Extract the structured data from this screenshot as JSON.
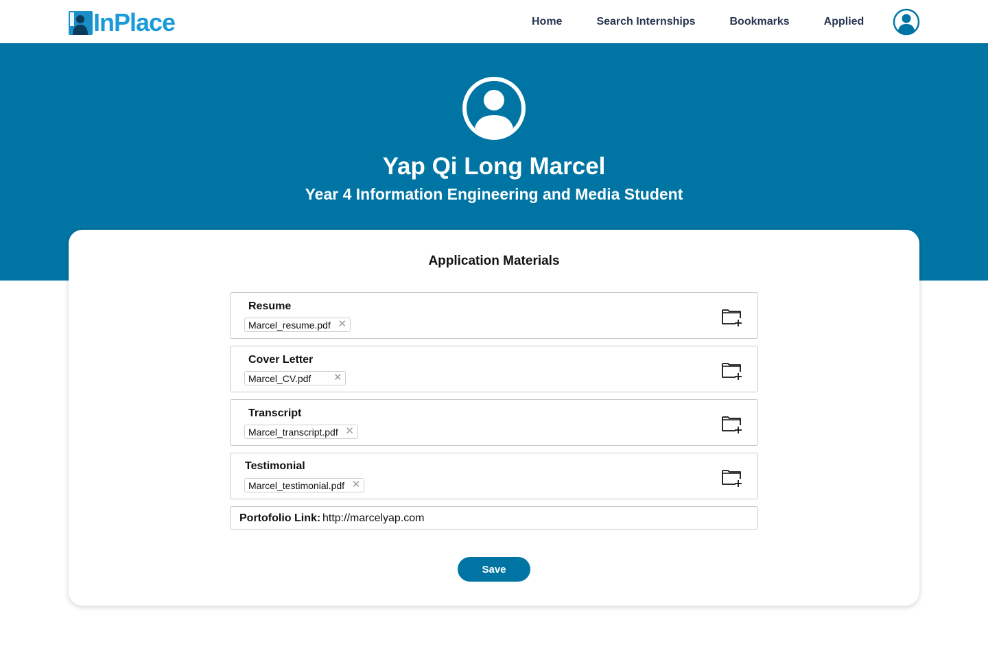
{
  "brand": {
    "logo_text": "InPlace",
    "logo_icon": "person-badge-icon",
    "color": "#1a9ad6"
  },
  "nav": {
    "items": [
      {
        "label": "Home"
      },
      {
        "label": "Search Internships"
      },
      {
        "label": "Bookmarks"
      },
      {
        "label": "Applied"
      }
    ],
    "avatar_icon": "user-circle-icon"
  },
  "profile": {
    "name": "Yap Qi Long Marcel",
    "subtitle": "Year 4 Information Engineering and Media Student",
    "avatar_icon": "user-circle-icon"
  },
  "materials": {
    "title": "Application Materials",
    "items": [
      {
        "label": "Resume",
        "file": "Marcel_resume.pdf",
        "remove_icon": "close-icon",
        "upload_icon": "folder-add-icon"
      },
      {
        "label": "Cover Letter",
        "file": "Marcel_CV.pdf",
        "remove_icon": "close-icon",
        "upload_icon": "folder-add-icon"
      },
      {
        "label": "Transcript",
        "file": "Marcel_transcript.pdf",
        "remove_icon": "close-icon",
        "upload_icon": "folder-add-icon"
      },
      {
        "label": "Testimonial",
        "file": "Marcel_testimonial.pdf",
        "remove_icon": "close-icon",
        "upload_icon": "folder-add-icon"
      }
    ],
    "portfolio": {
      "label": "Portofolio Link:",
      "value": "http://marcelyap.com"
    },
    "save_label": "Save"
  },
  "colors": {
    "primary": "#0075a4",
    "nav_text": "#26354f"
  }
}
